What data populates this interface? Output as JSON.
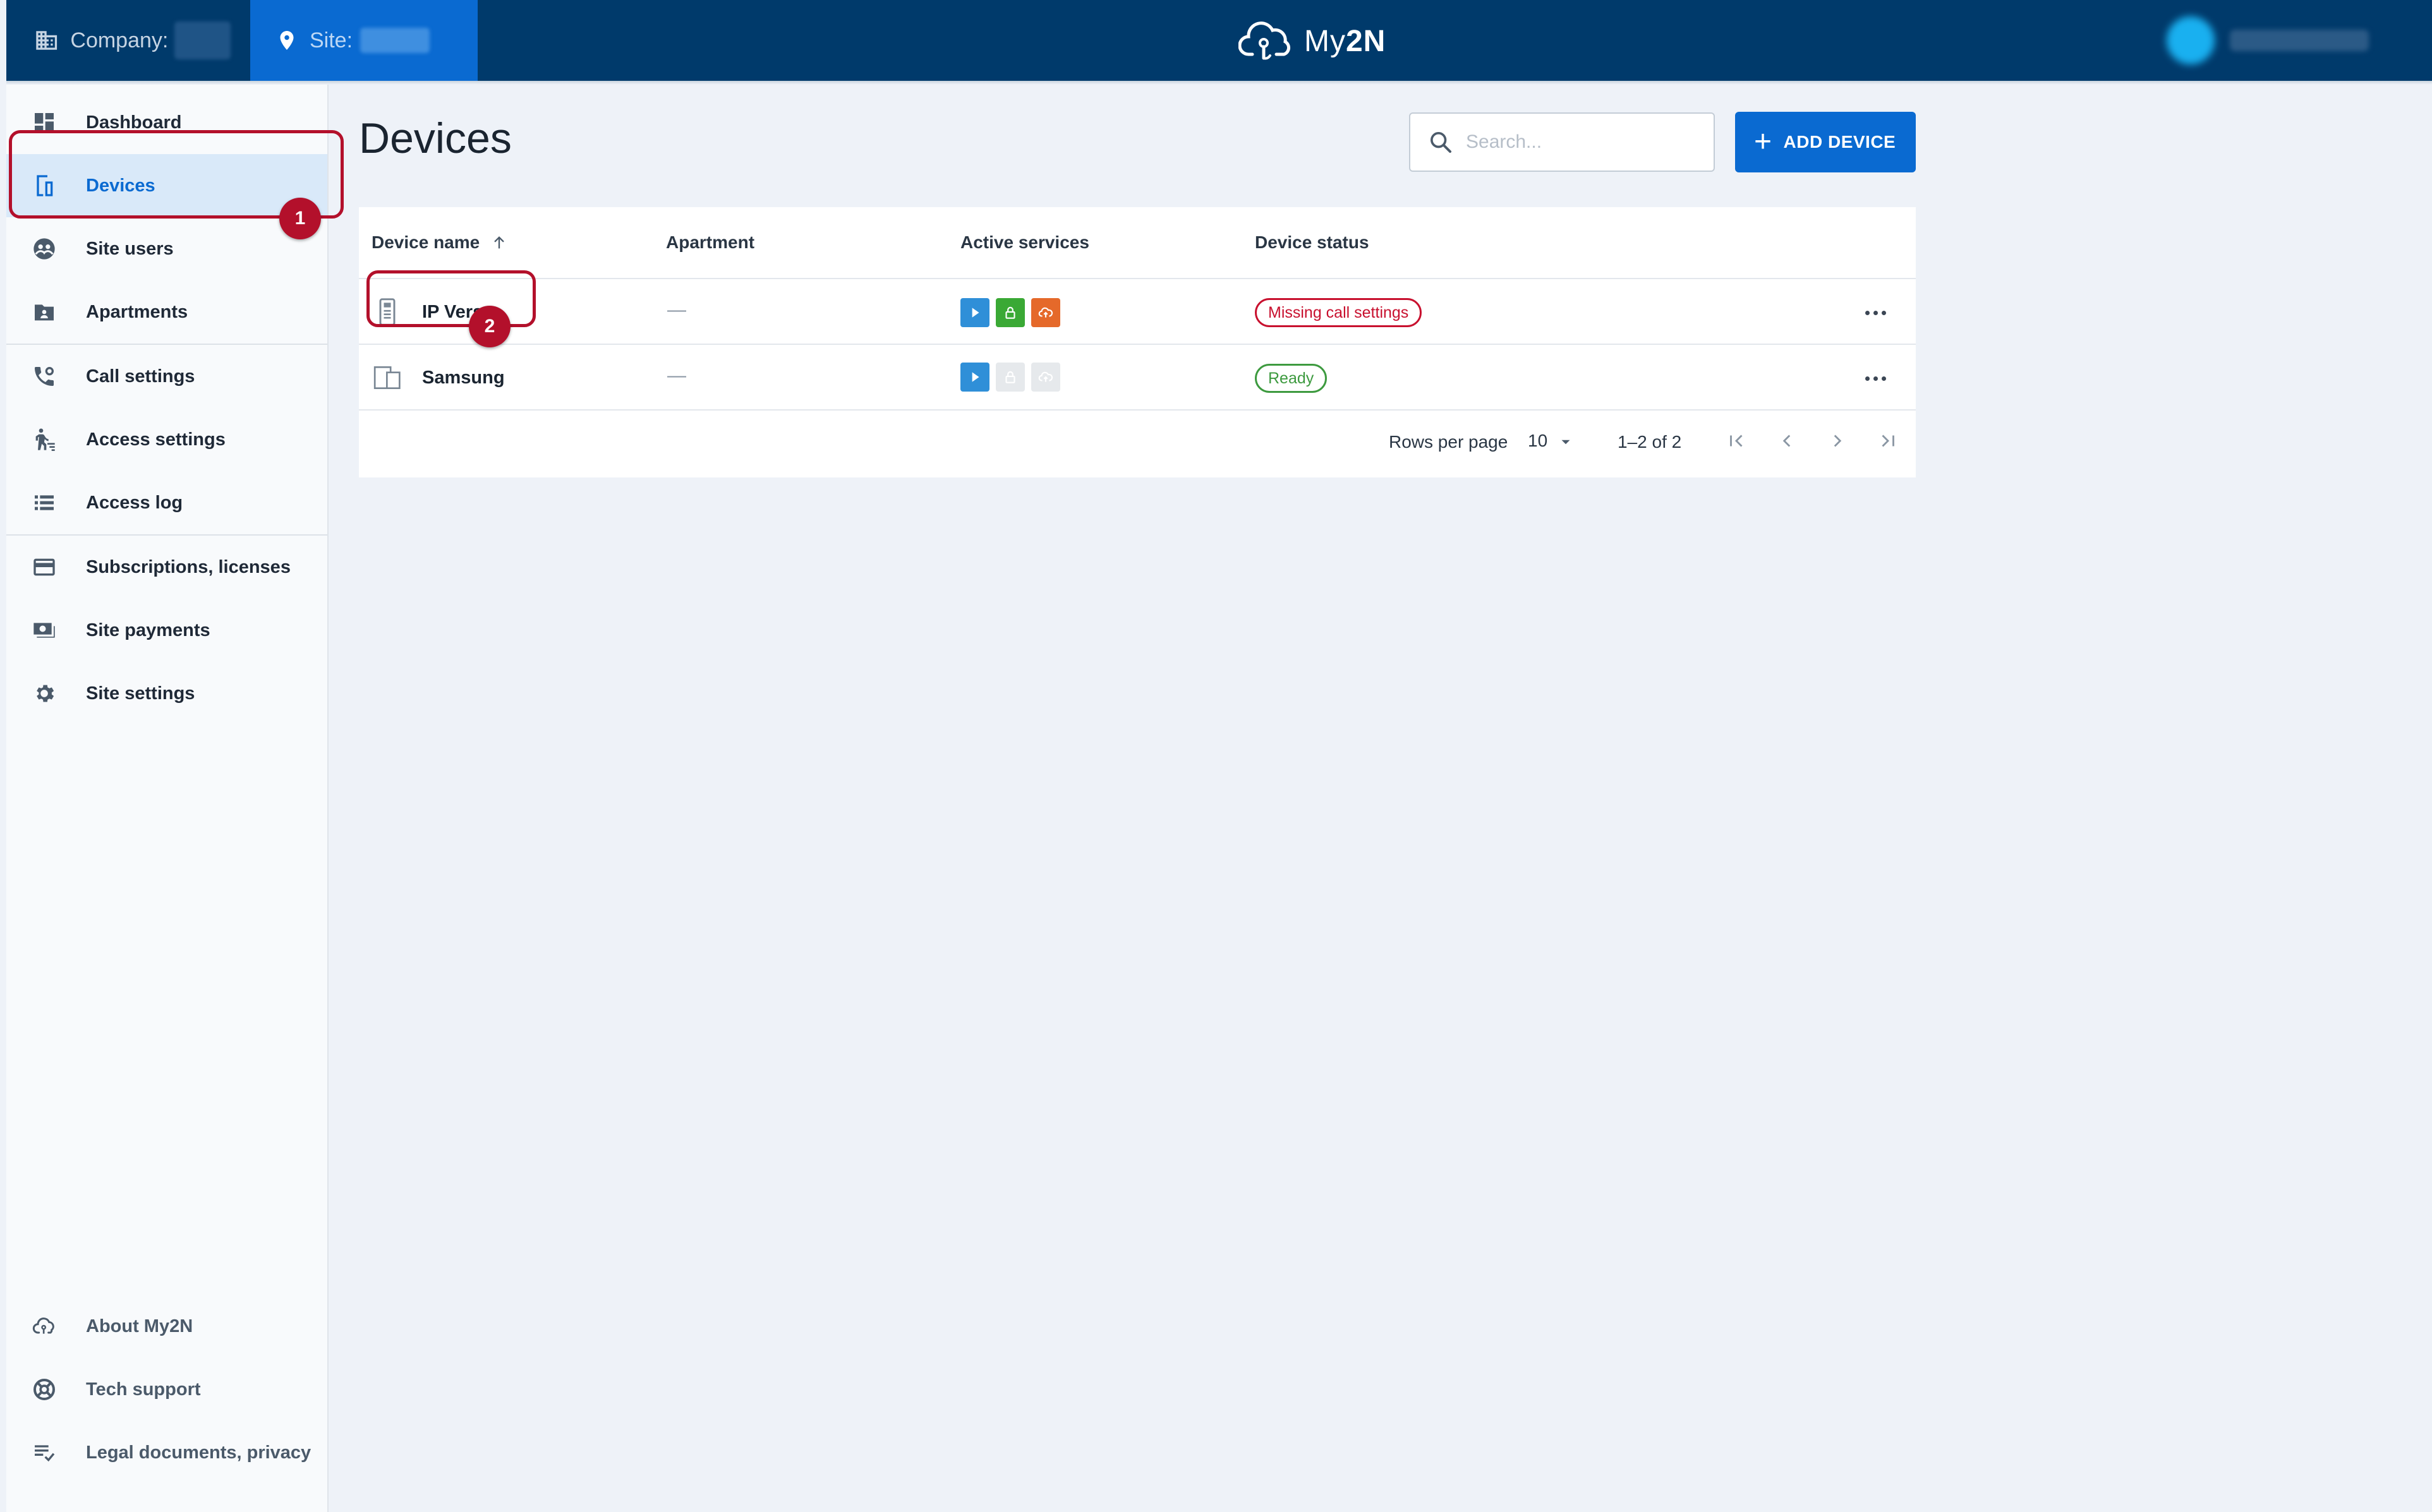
{
  "header": {
    "company_label": "Company:",
    "site_label": "Site:",
    "brand_prefix": "My",
    "brand_suffix": "2N"
  },
  "sidebar": {
    "items": [
      {
        "label": "Dashboard",
        "icon": "dashboard-icon"
      },
      {
        "label": "Devices",
        "icon": "device-icon",
        "active": true
      },
      {
        "label": "Site users",
        "icon": "users-icon"
      },
      {
        "label": "Apartments",
        "icon": "apartment-icon"
      },
      {
        "label": "Call settings",
        "icon": "phone-settings-icon"
      },
      {
        "label": "Access settings",
        "icon": "access-icon"
      },
      {
        "label": "Access log",
        "icon": "list-icon"
      },
      {
        "label": "Subscriptions, licenses",
        "icon": "card-icon"
      },
      {
        "label": "Site payments",
        "icon": "payment-icon"
      },
      {
        "label": "Site settings",
        "icon": "gear-icon"
      }
    ],
    "footer": [
      {
        "label": "About My2N",
        "icon": "cloud-icon"
      },
      {
        "label": "Tech support",
        "icon": "support-icon"
      },
      {
        "label": "Legal documents, privacy",
        "icon": "legal-icon"
      }
    ]
  },
  "main": {
    "title": "Devices",
    "search_placeholder": "Search...",
    "add_button": "ADD DEVICE",
    "table": {
      "columns": [
        "Device name",
        "Apartment",
        "Active services",
        "Device status"
      ],
      "rows": [
        {
          "name": "IP Vers",
          "apartment": "—",
          "status": "Missing call settings",
          "status_color": "#c8102e",
          "services": [
            "active",
            "active",
            "active"
          ]
        },
        {
          "name": "Samsung",
          "apartment": "—",
          "status": "Ready",
          "status_color": "#3d9a3f",
          "services": [
            "active",
            "inactive",
            "inactive"
          ]
        }
      ]
    },
    "pagination": {
      "rows_per_page_label": "Rows per page",
      "rows_per_page_value": "10",
      "range": "1–2 of 2"
    }
  },
  "callouts": [
    "1",
    "2"
  ],
  "colors": {
    "header_bg": "#003a6b",
    "accent": "#0a6ad1",
    "callout": "#b3102b",
    "service_mobile": "#2f8fd8",
    "service_lock": "#3aa935",
    "service_cloud": "#e5692a"
  }
}
